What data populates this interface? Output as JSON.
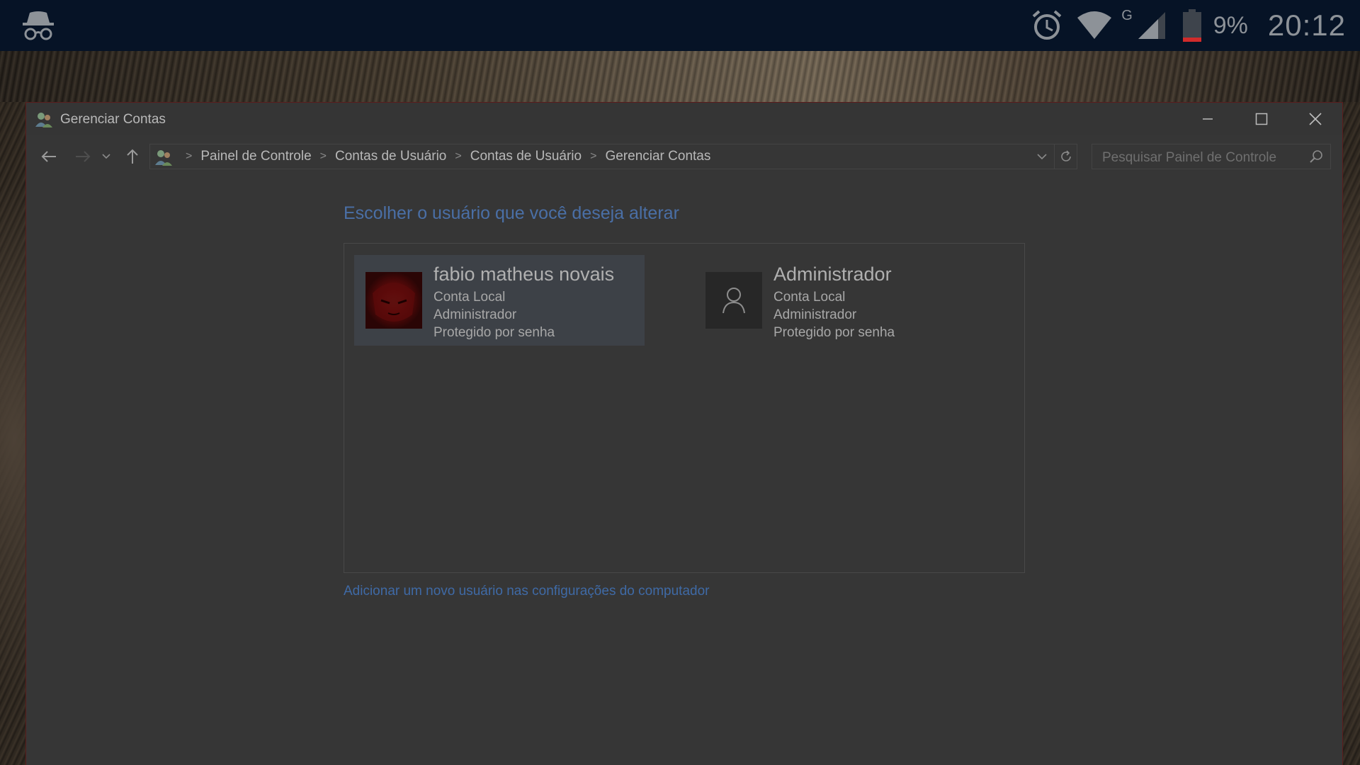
{
  "status_bar": {
    "icons": [
      "incognito-icon",
      "alarm-icon",
      "wifi-icon",
      "signal-icon",
      "battery-icon"
    ],
    "network_type": "G",
    "battery_percent": "9%",
    "clock": "20:12",
    "battery_color": "#d12b2b"
  },
  "window": {
    "title": "Gerenciar Contas",
    "controls": [
      "minimize",
      "maximize",
      "close"
    ]
  },
  "address": {
    "breadcrumbs": [
      "Painel de Controle",
      "Contas de Usuário",
      "Contas de Usuário",
      "Gerenciar Contas"
    ]
  },
  "search": {
    "placeholder": "Pesquisar Painel de Controle"
  },
  "main": {
    "heading": "Escolher o usuário que você deseja alterar",
    "users": [
      {
        "name": "fabio matheus novais",
        "type": "Conta Local",
        "role": "Administrador",
        "protection": "Protegido por senha",
        "avatar": "photo",
        "selected": true
      },
      {
        "name": "Administrador",
        "type": "Conta Local",
        "role": "Administrador",
        "protection": "Protegido por senha",
        "avatar": "default-user-icon",
        "selected": false
      }
    ],
    "add_user_link": "Adicionar um novo usuário nas configurações do computador"
  },
  "colors": {
    "heading_blue": "#4a6fa6",
    "link_blue": "#3f6aa6",
    "window_bg": "#363636",
    "status_bar_bg": "#061326"
  }
}
